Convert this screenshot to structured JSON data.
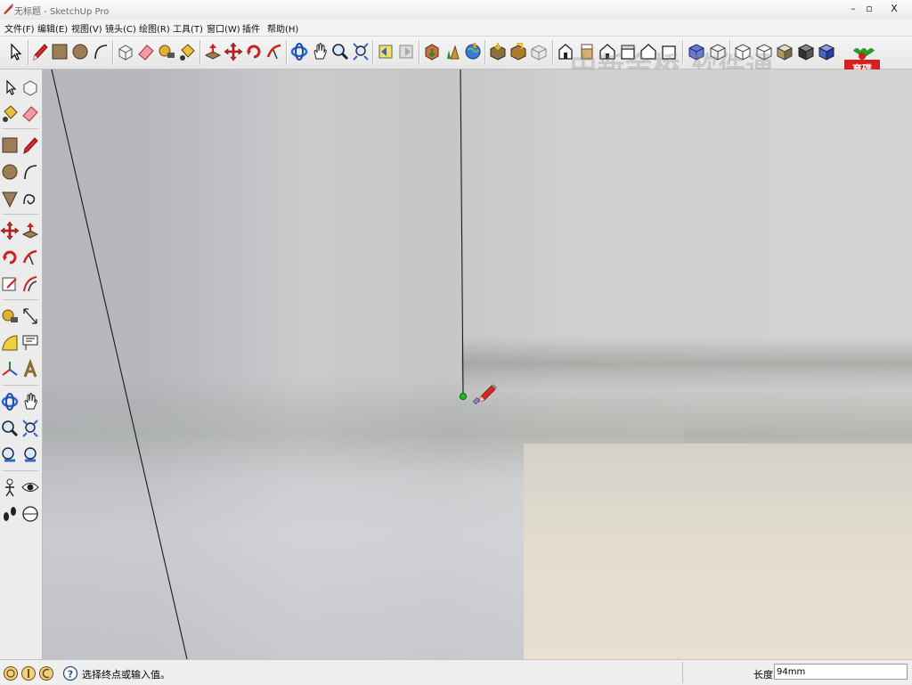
{
  "window": {
    "title": "无标题 - SketchUp Pro",
    "controls": {
      "minimize": "–",
      "maximize": "▫",
      "close": "X"
    }
  },
  "menu": {
    "items": [
      "文件(F)",
      "编辑(E)",
      "视图(V)",
      "镜头(C)",
      "绘图(R)",
      "工具(T)",
      "窗口(W)",
      "插件",
      "帮助(H)"
    ]
  },
  "toolbar": {
    "icons": [
      "select-icon",
      "pencil-icon",
      "rectangle-icon",
      "circle-icon",
      "arc-icon",
      "make-component-icon",
      "eraser-icon",
      "tape-measure-icon",
      "paint-bucket-icon",
      "push-pull-icon",
      "move-icon",
      "rotate-icon",
      "follow-me-icon",
      "orbit-icon",
      "pan-icon",
      "zoom-icon",
      "zoom-extents-icon",
      "previous-view-icon",
      "next-view-icon",
      "get-models-icon",
      "share-model-icon",
      "google-earth-icon",
      "photo-texture-icon",
      "add-location-icon",
      "toggle-terrain-icon",
      "iso-view-icon",
      "top-view-icon",
      "front-view-icon",
      "right-view-icon",
      "back-view-icon",
      "left-view-icon",
      "xray-icon",
      "wireframe-icon",
      "hidden-line-icon",
      "shaded-icon",
      "shaded-textures-icon",
      "monochrome-icon"
    ]
  },
  "overlays": {
    "watermark_text": "中新金桥 软件通",
    "logo_text": "育碟软件"
  },
  "left_toolbar": {
    "icons": [
      "select-icon",
      "make-component-icon",
      "paint-bucket-icon",
      "eraser-icon",
      "rectangle-icon",
      "line-icon",
      "circle-icon",
      "arc-icon",
      "polygon-icon",
      "freehand-icon",
      "move-icon",
      "push-pull-icon",
      "rotate-icon",
      "follow-me-icon",
      "scale-icon",
      "offset-icon",
      "tape-measure-icon",
      "dimension-icon",
      "protractor-icon",
      "text-icon",
      "axes-icon",
      "3d-text-icon",
      "orbit-icon",
      "pan-icon",
      "zoom-icon",
      "zoom-window-icon",
      "previous-view-icon",
      "next-view-icon",
      "position-camera-icon",
      "look-around-icon",
      "walk-icon",
      "section-plane-icon"
    ]
  },
  "viewport": {
    "cursor": "pencil-cursor-icon",
    "inference_point": "endpoint-marker"
  },
  "status": {
    "left_icons": [
      "geo-location-icon",
      "credits-icon",
      "user-icon",
      "help-icon"
    ],
    "message": "选择终点或输入值。",
    "measure_label": "长度",
    "measure_value": "94mm"
  },
  "colors": {
    "accent_red": "#cc2222",
    "inference_green": "#22aa22",
    "toolbar_bg": "#e9e9e9"
  }
}
